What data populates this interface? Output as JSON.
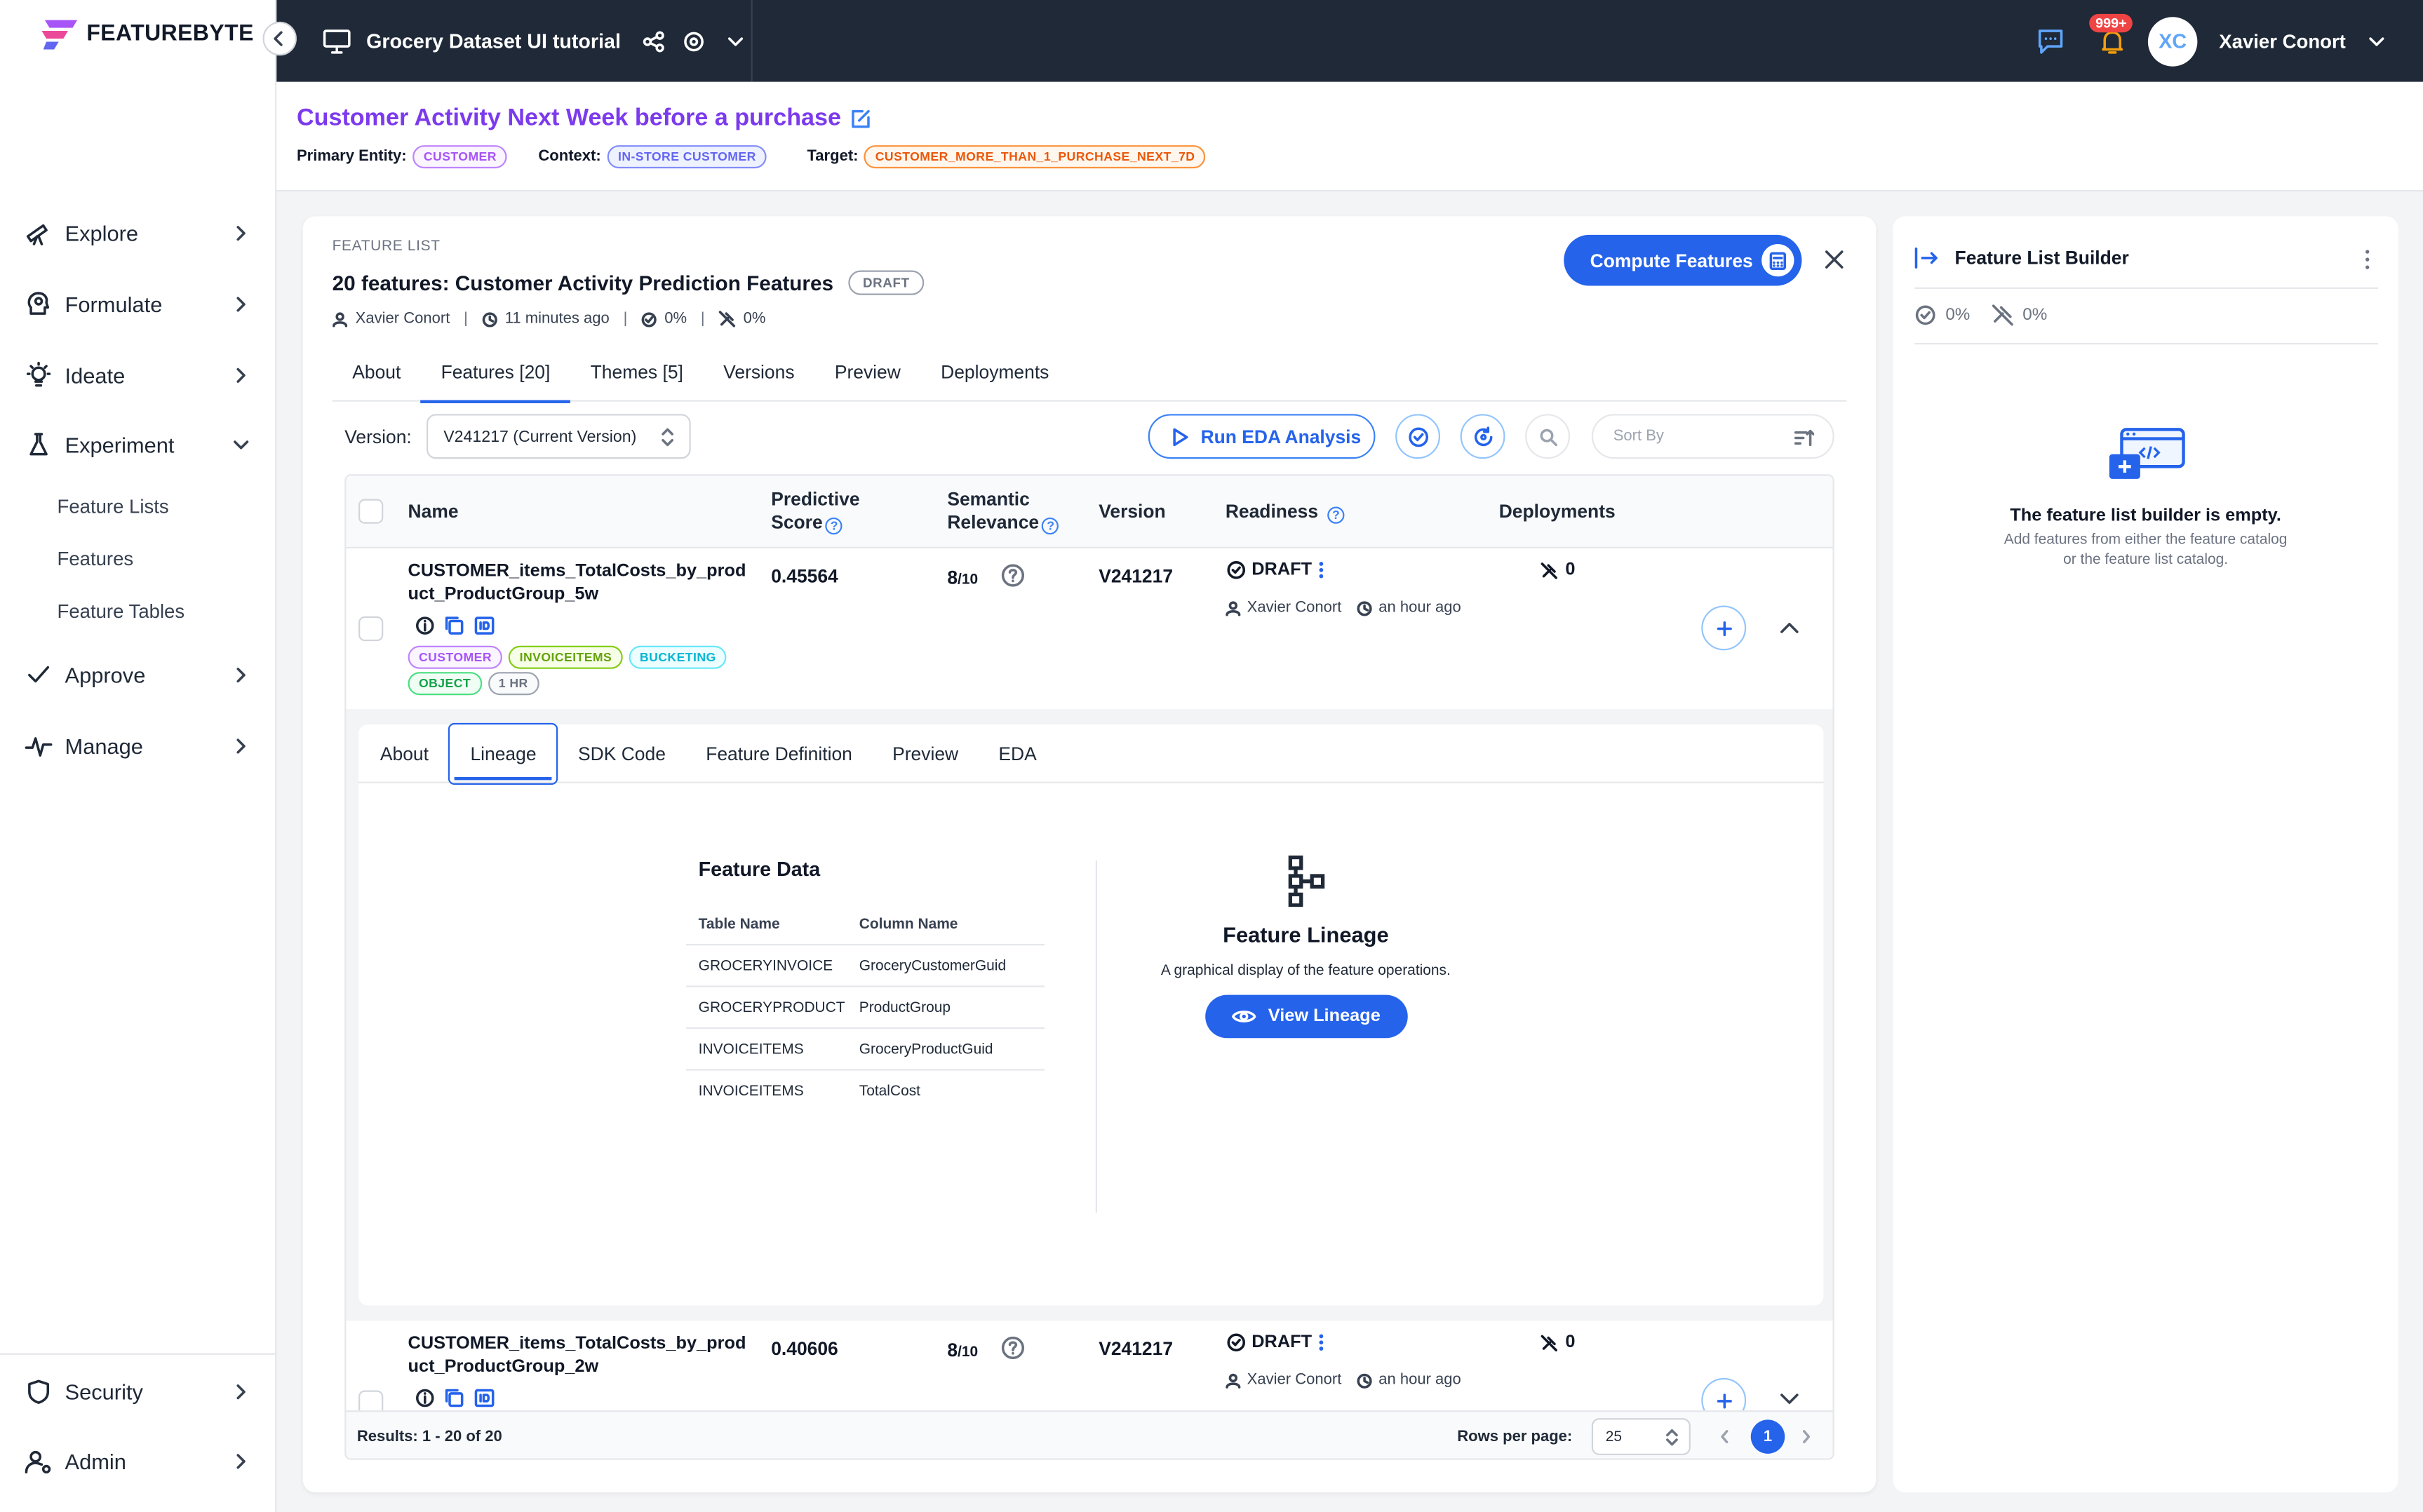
{
  "brand": {
    "name": "FEATUREBYTE"
  },
  "sidebar": {
    "items": [
      {
        "label": "Explore"
      },
      {
        "label": "Formulate"
      },
      {
        "label": "Ideate"
      },
      {
        "label": "Experiment"
      },
      {
        "label": "Approve"
      },
      {
        "label": "Manage"
      },
      {
        "label": "Security"
      },
      {
        "label": "Admin"
      }
    ],
    "experiment_sub": [
      {
        "label": "Feature Lists"
      },
      {
        "label": "Features"
      },
      {
        "label": "Feature Tables"
      }
    ]
  },
  "topbar": {
    "project": "Grocery Dataset UI tutorial",
    "notifications": "999+",
    "avatar_initials": "XC",
    "user_name": "Xavier Conort"
  },
  "header": {
    "title": "Customer Activity Next Week before a purchase",
    "primary_entity_label": "Primary Entity:",
    "primary_entity": "CUSTOMER",
    "context_label": "Context:",
    "context": "IN-STORE CUSTOMER",
    "target_label": "Target:",
    "target": "CUSTOMER_MORE_THAN_1_PURCHASE_NEXT_7D"
  },
  "feature_list": {
    "overline": "FEATURE LIST",
    "title": "20 features: Customer Activity Prediction Features",
    "status": "DRAFT",
    "owner": "Xavier Conort",
    "updated": "11 minutes ago",
    "readiness_pct": "0%",
    "deploy_pct": "0%",
    "compute_label": "Compute Features",
    "tabs": [
      {
        "label": "About"
      },
      {
        "label": "Features [20]"
      },
      {
        "label": "Themes [5]"
      },
      {
        "label": "Versions"
      },
      {
        "label": "Preview"
      },
      {
        "label": "Deployments"
      }
    ],
    "version_label": "Version:",
    "version_value": "V241217 (Current Version)",
    "eda_label": "Run EDA Analysis",
    "sort_placeholder": "Sort By"
  },
  "table": {
    "headers": {
      "name": "Name",
      "predictive_1": "Predictive",
      "predictive_2": "Score",
      "semantic_1": "Semantic",
      "semantic_2": "Relevance",
      "version": "Version",
      "readiness": "Readiness",
      "deployments": "Deployments"
    },
    "rows": [
      {
        "name": "CUSTOMER_items_TotalCosts_by_product_ProductGroup_5w",
        "score": "0.45564",
        "relevance": "8",
        "relevance_max": "/10",
        "version": "V241217",
        "readiness": "DRAFT",
        "owner": "Xavier Conort",
        "time": "an hour ago",
        "deployments": "0",
        "tags": [
          "CUSTOMER",
          "INVOICEITEMS",
          "BUCKETING",
          "OBJECT",
          "1 HR"
        ]
      },
      {
        "name": "CUSTOMER_items_TotalCosts_by_product_ProductGroup_2w",
        "score": "0.40606",
        "relevance": "8",
        "relevance_max": "/10",
        "version": "V241217",
        "readiness": "DRAFT",
        "owner": "Xavier Conort",
        "time": "an hour ago",
        "deployments": "0"
      }
    ],
    "results": "Results: 1 - 20 of 20",
    "rows_per_page_label": "Rows per page:",
    "rows_per_page": "25",
    "current_page": "1"
  },
  "detail": {
    "tabs": [
      {
        "label": "About"
      },
      {
        "label": "Lineage"
      },
      {
        "label": "SDK Code"
      },
      {
        "label": "Feature Definition"
      },
      {
        "label": "Preview"
      },
      {
        "label": "EDA"
      }
    ],
    "feature_data_title": "Feature Data",
    "col_table": "Table Name",
    "col_column": "Column Name",
    "data_rows": [
      {
        "table": "GROCERYINVOICE",
        "column": "GroceryCustomerGuid"
      },
      {
        "table": "GROCERYPRODUCT",
        "column": "ProductGroup"
      },
      {
        "table": "INVOICEITEMS",
        "column": "GroceryProductGuid"
      },
      {
        "table": "INVOICEITEMS",
        "column": "TotalCost"
      }
    ],
    "lineage_title": "Feature Lineage",
    "lineage_desc": "A graphical display of the feature operations.",
    "lineage_button": "View Lineage"
  },
  "builder": {
    "title": "Feature List Builder",
    "readiness_pct": "0%",
    "deploy_pct": "0%",
    "empty_title": "The feature list builder is empty.",
    "empty_desc_1": "Add features from either the feature catalog",
    "empty_desc_2": "or the feature list catalog."
  }
}
